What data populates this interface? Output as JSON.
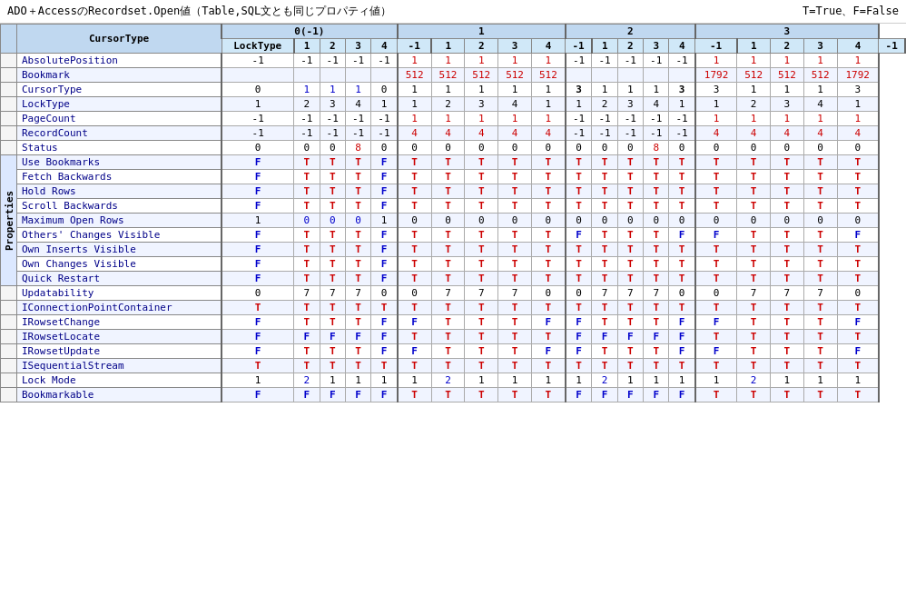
{
  "title": "ADO＋AccessのRecordset.Open値（Table,SQL文とも同じプロパティ値）",
  "legend": "T=True、F=False",
  "headers": {
    "cursorType": "CursorType",
    "lockType": "LockType",
    "cursorValues": [
      "0(-1)",
      "1",
      "2",
      "3"
    ],
    "lockValues": [
      "1",
      "2",
      "3",
      "4",
      "-1"
    ]
  },
  "groupLabel": "Properties",
  "rows": [
    {
      "name": "AbsolutePosition",
      "c0": [
        "-1",
        "-1",
        "-1",
        "-1",
        "-1"
      ],
      "c1": [
        "1",
        "1",
        "1",
        "1",
        "1"
      ],
      "c2": [
        "-1",
        "-1",
        "-1",
        "-1",
        "-1"
      ],
      "c3": [
        "1",
        "1",
        "1",
        "1",
        "1"
      ],
      "c0_style": [
        "bk",
        "bk",
        "bk",
        "bk",
        "bk"
      ],
      "c1_style": [
        "red",
        "red",
        "red",
        "red",
        "red"
      ],
      "c2_style": [
        "bk",
        "bk",
        "bk",
        "bk",
        "bk"
      ],
      "c3_style": [
        "red",
        "red",
        "red",
        "red",
        "red"
      ]
    },
    {
      "name": "Bookmark",
      "c0": [
        "",
        "",
        "",
        "",
        ""
      ],
      "c1": [
        "512",
        "512",
        "512",
        "512",
        "512"
      ],
      "c2": [
        "",
        "",
        "",
        "",
        ""
      ],
      "c3": [
        "1792",
        "512",
        "512",
        "512",
        "1792"
      ],
      "c0_style": [
        "bk",
        "bk",
        "bk",
        "bk",
        "bk"
      ],
      "c1_style": [
        "red",
        "red",
        "red",
        "red",
        "red"
      ],
      "c2_style": [
        "bk",
        "bk",
        "bk",
        "bk",
        "bk"
      ],
      "c3_style": [
        "red",
        "red",
        "red",
        "red",
        "red"
      ]
    },
    {
      "name": "CursorType",
      "c0": [
        "0",
        "1",
        "1",
        "1",
        "0"
      ],
      "c1": [
        "1",
        "1",
        "1",
        "1",
        "1"
      ],
      "c2": [
        "3",
        "1",
        "1",
        "1",
        "3"
      ],
      "c3": [
        "3",
        "1",
        "1",
        "1",
        "3"
      ],
      "c0_style": [
        "bk",
        "blue",
        "blue",
        "blue",
        "bk"
      ],
      "c1_style": [
        "bk",
        "bk",
        "bk",
        "bk",
        "bk"
      ],
      "c2_style": [
        "bold",
        "bk",
        "bk",
        "bk",
        "bold"
      ],
      "c3_style": [
        "bk",
        "bk",
        "bk",
        "bk",
        "bk"
      ]
    },
    {
      "name": "LockType",
      "c0": [
        "1",
        "2",
        "3",
        "4",
        "1"
      ],
      "c1": [
        "1",
        "2",
        "3",
        "4",
        "1"
      ],
      "c2": [
        "1",
        "2",
        "3",
        "4",
        "1"
      ],
      "c3": [
        "1",
        "2",
        "3",
        "4",
        "1"
      ],
      "c0_style": [
        "bk",
        "bk",
        "bk",
        "bk",
        "bk"
      ],
      "c1_style": [
        "bk",
        "bk",
        "bk",
        "bk",
        "bk"
      ],
      "c2_style": [
        "bk",
        "bk",
        "bk",
        "bk",
        "bk"
      ],
      "c3_style": [
        "bk",
        "bk",
        "bk",
        "bk",
        "bk"
      ]
    },
    {
      "name": "PageCount",
      "c0": [
        "-1",
        "-1",
        "-1",
        "-1",
        "-1"
      ],
      "c1": [
        "1",
        "1",
        "1",
        "1",
        "1"
      ],
      "c2": [
        "-1",
        "-1",
        "-1",
        "-1",
        "-1"
      ],
      "c3": [
        "1",
        "1",
        "1",
        "1",
        "1"
      ],
      "c0_style": [
        "bk",
        "bk",
        "bk",
        "bk",
        "bk"
      ],
      "c1_style": [
        "red",
        "red",
        "red",
        "red",
        "red"
      ],
      "c2_style": [
        "bk",
        "bk",
        "bk",
        "bk",
        "bk"
      ],
      "c3_style": [
        "red",
        "red",
        "red",
        "red",
        "red"
      ]
    },
    {
      "name": "RecordCount",
      "c0": [
        "-1",
        "-1",
        "-1",
        "-1",
        "-1"
      ],
      "c1": [
        "4",
        "4",
        "4",
        "4",
        "4"
      ],
      "c2": [
        "-1",
        "-1",
        "-1",
        "-1",
        "-1"
      ],
      "c3": [
        "4",
        "4",
        "4",
        "4",
        "4"
      ],
      "c0_style": [
        "bk",
        "bk",
        "bk",
        "bk",
        "bk"
      ],
      "c1_style": [
        "red",
        "red",
        "red",
        "red",
        "red"
      ],
      "c2_style": [
        "bk",
        "bk",
        "bk",
        "bk",
        "bk"
      ],
      "c3_style": [
        "red",
        "red",
        "red",
        "red",
        "red"
      ]
    },
    {
      "name": "Status",
      "c0": [
        "0",
        "0",
        "0",
        "8",
        "0"
      ],
      "c1": [
        "0",
        "0",
        "0",
        "0",
        "0"
      ],
      "c2": [
        "0",
        "0",
        "0",
        "8",
        "0"
      ],
      "c3": [
        "0",
        "0",
        "0",
        "0",
        "0"
      ],
      "c0_style": [
        "bk",
        "bk",
        "bk",
        "red",
        "bk"
      ],
      "c1_style": [
        "bk",
        "bk",
        "bk",
        "bk",
        "bk"
      ],
      "c2_style": [
        "bk",
        "bk",
        "bk",
        "red",
        "bk"
      ],
      "c3_style": [
        "bk",
        "bk",
        "bk",
        "bk",
        "bk"
      ]
    },
    {
      "name": "Use Bookmarks",
      "c0": [
        "F",
        "T",
        "T",
        "T",
        "F"
      ],
      "c1": [
        "T",
        "T",
        "T",
        "T",
        "T"
      ],
      "c2": [
        "T",
        "T",
        "T",
        "T",
        "T"
      ],
      "c3": [
        "T",
        "T",
        "T",
        "T",
        "T"
      ],
      "c0_style": [
        "F",
        "T",
        "T",
        "T",
        "F"
      ],
      "c1_style": [
        "T",
        "T",
        "T",
        "T",
        "T"
      ],
      "c2_style": [
        "T",
        "T",
        "T",
        "T",
        "T"
      ],
      "c3_style": [
        "T",
        "T",
        "T",
        "T",
        "T"
      ],
      "isBool": true
    },
    {
      "name": "Fetch Backwards",
      "c0": [
        "F",
        "T",
        "T",
        "T",
        "F"
      ],
      "c1": [
        "T",
        "T",
        "T",
        "T",
        "T"
      ],
      "c2": [
        "T",
        "T",
        "T",
        "T",
        "T"
      ],
      "c3": [
        "T",
        "T",
        "T",
        "T",
        "T"
      ],
      "c0_style": [
        "F",
        "T",
        "T",
        "T",
        "F"
      ],
      "c1_style": [
        "T",
        "T",
        "T",
        "T",
        "T"
      ],
      "c2_style": [
        "T",
        "T",
        "T",
        "T",
        "T"
      ],
      "c3_style": [
        "T",
        "T",
        "T",
        "T",
        "T"
      ],
      "isBool": true
    },
    {
      "name": "Hold Rows",
      "c0": [
        "F",
        "T",
        "T",
        "T",
        "F"
      ],
      "c1": [
        "T",
        "T",
        "T",
        "T",
        "T"
      ],
      "c2": [
        "T",
        "T",
        "T",
        "T",
        "T"
      ],
      "c3": [
        "T",
        "T",
        "T",
        "T",
        "T"
      ],
      "c0_style": [
        "F",
        "T",
        "T",
        "T",
        "F"
      ],
      "c1_style": [
        "T",
        "T",
        "T",
        "T",
        "T"
      ],
      "c2_style": [
        "T",
        "T",
        "T",
        "T",
        "T"
      ],
      "c3_style": [
        "T",
        "T",
        "T",
        "T",
        "T"
      ],
      "isBool": true
    },
    {
      "name": "Scroll Backwards",
      "c0": [
        "F",
        "T",
        "T",
        "T",
        "F"
      ],
      "c1": [
        "T",
        "T",
        "T",
        "T",
        "T"
      ],
      "c2": [
        "T",
        "T",
        "T",
        "T",
        "T"
      ],
      "c3": [
        "T",
        "T",
        "T",
        "T",
        "T"
      ],
      "c0_style": [
        "F",
        "T",
        "T",
        "T",
        "F"
      ],
      "c1_style": [
        "T",
        "T",
        "T",
        "T",
        "T"
      ],
      "c2_style": [
        "T",
        "T",
        "T",
        "T",
        "T"
      ],
      "c3_style": [
        "T",
        "T",
        "T",
        "T",
        "T"
      ],
      "isBool": true
    },
    {
      "name": "Maximum Open Rows",
      "c0": [
        "1",
        "0",
        "0",
        "0",
        "1"
      ],
      "c1": [
        "0",
        "0",
        "0",
        "0",
        "0"
      ],
      "c2": [
        "0",
        "0",
        "0",
        "0",
        "0"
      ],
      "c3": [
        "0",
        "0",
        "0",
        "0",
        "0"
      ],
      "c0_style": [
        "bk",
        "blue",
        "blue",
        "blue",
        "bk"
      ],
      "c1_style": [
        "bk",
        "bk",
        "bk",
        "bk",
        "bk"
      ],
      "c2_style": [
        "bk",
        "bk",
        "bk",
        "bk",
        "bk"
      ],
      "c3_style": [
        "bk",
        "bk",
        "bk",
        "bk",
        "bk"
      ]
    },
    {
      "name": "Others' Changes Visible",
      "c0": [
        "F",
        "T",
        "T",
        "T",
        "F"
      ],
      "c1": [
        "T",
        "T",
        "T",
        "T",
        "T"
      ],
      "c2": [
        "F",
        "T",
        "T",
        "T",
        "F"
      ],
      "c3": [
        "F",
        "T",
        "T",
        "T",
        "F"
      ],
      "c0_style": [
        "F",
        "T",
        "T",
        "T",
        "F"
      ],
      "c1_style": [
        "T",
        "T",
        "T",
        "T",
        "T"
      ],
      "c2_style": [
        "F",
        "T",
        "T",
        "T",
        "F"
      ],
      "c3_style": [
        "F",
        "T",
        "T",
        "T",
        "F"
      ],
      "isBool": true
    },
    {
      "name": "Own Inserts Visible",
      "c0": [
        "F",
        "T",
        "T",
        "T",
        "F"
      ],
      "c1": [
        "T",
        "T",
        "T",
        "T",
        "T"
      ],
      "c2": [
        "T",
        "T",
        "T",
        "T",
        "T"
      ],
      "c3": [
        "T",
        "T",
        "T",
        "T",
        "T"
      ],
      "c0_style": [
        "F",
        "T",
        "T",
        "T",
        "F"
      ],
      "c1_style": [
        "T",
        "T",
        "T",
        "T",
        "T"
      ],
      "c2_style": [
        "T",
        "T",
        "T",
        "T",
        "T"
      ],
      "c3_style": [
        "T",
        "T",
        "T",
        "T",
        "T"
      ],
      "isBool": true
    },
    {
      "name": "Own Changes Visible",
      "c0": [
        "F",
        "T",
        "T",
        "T",
        "F"
      ],
      "c1": [
        "T",
        "T",
        "T",
        "T",
        "T"
      ],
      "c2": [
        "T",
        "T",
        "T",
        "T",
        "T"
      ],
      "c3": [
        "T",
        "T",
        "T",
        "T",
        "T"
      ],
      "c0_style": [
        "F",
        "T",
        "T",
        "T",
        "F"
      ],
      "c1_style": [
        "T",
        "T",
        "T",
        "T",
        "T"
      ],
      "c2_style": [
        "T",
        "T",
        "T",
        "T",
        "T"
      ],
      "c3_style": [
        "T",
        "T",
        "T",
        "T",
        "T"
      ],
      "isBool": true
    },
    {
      "name": "Quick Restart",
      "c0": [
        "F",
        "T",
        "T",
        "T",
        "F"
      ],
      "c1": [
        "T",
        "T",
        "T",
        "T",
        "T"
      ],
      "c2": [
        "T",
        "T",
        "T",
        "T",
        "T"
      ],
      "c3": [
        "T",
        "T",
        "T",
        "T",
        "T"
      ],
      "c0_style": [
        "F",
        "T",
        "T",
        "T",
        "F"
      ],
      "c1_style": [
        "T",
        "T",
        "T",
        "T",
        "T"
      ],
      "c2_style": [
        "T",
        "T",
        "T",
        "T",
        "T"
      ],
      "c3_style": [
        "T",
        "T",
        "T",
        "T",
        "T"
      ],
      "isBool": true
    },
    {
      "name": "Updatability",
      "c0": [
        "0",
        "7",
        "7",
        "7",
        "0"
      ],
      "c1": [
        "0",
        "7",
        "7",
        "7",
        "0"
      ],
      "c2": [
        "0",
        "7",
        "7",
        "7",
        "0"
      ],
      "c3": [
        "0",
        "7",
        "7",
        "7",
        "0"
      ],
      "c0_style": [
        "bk",
        "bk",
        "bk",
        "bk",
        "bk"
      ],
      "c1_style": [
        "bk",
        "bk",
        "bk",
        "bk",
        "bk"
      ],
      "c2_style": [
        "bk",
        "bk",
        "bk",
        "bk",
        "bk"
      ],
      "c3_style": [
        "bk",
        "bk",
        "bk",
        "bk",
        "bk"
      ]
    },
    {
      "name": "IConnectionPointContainer",
      "c0": [
        "T",
        "T",
        "T",
        "T",
        "T"
      ],
      "c1": [
        "T",
        "T",
        "T",
        "T",
        "T"
      ],
      "c2": [
        "T",
        "T",
        "T",
        "T",
        "T"
      ],
      "c3": [
        "T",
        "T",
        "T",
        "T",
        "T"
      ],
      "c0_style": [
        "T",
        "T",
        "T",
        "T",
        "T"
      ],
      "c1_style": [
        "T",
        "T",
        "T",
        "T",
        "T"
      ],
      "c2_style": [
        "T",
        "T",
        "T",
        "T",
        "T"
      ],
      "c3_style": [
        "T",
        "T",
        "T",
        "T",
        "T"
      ],
      "isBool": true
    },
    {
      "name": "IRowsetChange",
      "c0": [
        "F",
        "T",
        "T",
        "T",
        "F"
      ],
      "c1": [
        "F",
        "T",
        "T",
        "T",
        "F"
      ],
      "c2": [
        "F",
        "T",
        "T",
        "T",
        "F"
      ],
      "c3": [
        "F",
        "T",
        "T",
        "T",
        "F"
      ],
      "c0_style": [
        "F",
        "T",
        "T",
        "T",
        "F"
      ],
      "c1_style": [
        "F",
        "T",
        "T",
        "T",
        "F"
      ],
      "c2_style": [
        "F",
        "T",
        "T",
        "T",
        "F"
      ],
      "c3_style": [
        "F",
        "T",
        "T",
        "T",
        "F"
      ],
      "isBool": true
    },
    {
      "name": "IRowsetLocate",
      "c0": [
        "F",
        "F",
        "F",
        "F",
        "F"
      ],
      "c1": [
        "T",
        "T",
        "T",
        "T",
        "T"
      ],
      "c2": [
        "F",
        "F",
        "F",
        "F",
        "F"
      ],
      "c3": [
        "T",
        "T",
        "T",
        "T",
        "T"
      ],
      "c0_style": [
        "F",
        "F",
        "F",
        "F",
        "F"
      ],
      "c1_style": [
        "T",
        "T",
        "T",
        "T",
        "T"
      ],
      "c2_style": [
        "F",
        "F",
        "F",
        "F",
        "F"
      ],
      "c3_style": [
        "T",
        "T",
        "T",
        "T",
        "T"
      ],
      "isBool": true
    },
    {
      "name": "IRowsetUpdate",
      "c0": [
        "F",
        "T",
        "T",
        "T",
        "F"
      ],
      "c1": [
        "F",
        "T",
        "T",
        "T",
        "F"
      ],
      "c2": [
        "F",
        "T",
        "T",
        "T",
        "F"
      ],
      "c3": [
        "F",
        "T",
        "T",
        "T",
        "F"
      ],
      "c0_style": [
        "F",
        "T",
        "T",
        "T",
        "F"
      ],
      "c1_style": [
        "F",
        "T",
        "T",
        "T",
        "F"
      ],
      "c2_style": [
        "F",
        "T",
        "T",
        "T",
        "F"
      ],
      "c3_style": [
        "F",
        "T",
        "T",
        "T",
        "F"
      ],
      "isBool": true
    },
    {
      "name": "ISequentialStream",
      "c0": [
        "T",
        "T",
        "T",
        "T",
        "T"
      ],
      "c1": [
        "T",
        "T",
        "T",
        "T",
        "T"
      ],
      "c2": [
        "T",
        "T",
        "T",
        "T",
        "T"
      ],
      "c3": [
        "T",
        "T",
        "T",
        "T",
        "T"
      ],
      "c0_style": [
        "T",
        "T",
        "T",
        "T",
        "T"
      ],
      "c1_style": [
        "T",
        "T",
        "T",
        "T",
        "T"
      ],
      "c2_style": [
        "T",
        "T",
        "T",
        "T",
        "T"
      ],
      "c3_style": [
        "T",
        "T",
        "T",
        "T",
        "T"
      ],
      "isBool": true
    },
    {
      "name": "Lock Mode",
      "c0": [
        "1",
        "2",
        "1",
        "1",
        "1"
      ],
      "c1": [
        "1",
        "2",
        "1",
        "1",
        "1"
      ],
      "c2": [
        "1",
        "2",
        "1",
        "1",
        "1"
      ],
      "c3": [
        "1",
        "2",
        "1",
        "1",
        "1"
      ],
      "c0_style": [
        "bk",
        "blue",
        "bk",
        "bk",
        "bk"
      ],
      "c1_style": [
        "bk",
        "blue",
        "bk",
        "bk",
        "bk"
      ],
      "c2_style": [
        "bk",
        "blue",
        "bk",
        "bk",
        "bk"
      ],
      "c3_style": [
        "bk",
        "blue",
        "bk",
        "bk",
        "bk"
      ]
    },
    {
      "name": "Bookmarkable",
      "c0": [
        "F",
        "F",
        "F",
        "F",
        "F"
      ],
      "c1": [
        "T",
        "T",
        "T",
        "T",
        "T"
      ],
      "c2": [
        "F",
        "F",
        "F",
        "F",
        "F"
      ],
      "c3": [
        "T",
        "T",
        "T",
        "T",
        "T"
      ],
      "c0_style": [
        "F",
        "F",
        "F",
        "F",
        "F"
      ],
      "c1_style": [
        "T",
        "T",
        "T",
        "T",
        "T"
      ],
      "c2_style": [
        "F",
        "F",
        "F",
        "F",
        "F"
      ],
      "c3_style": [
        "T",
        "T",
        "T",
        "T",
        "T"
      ],
      "isBool": true
    }
  ]
}
